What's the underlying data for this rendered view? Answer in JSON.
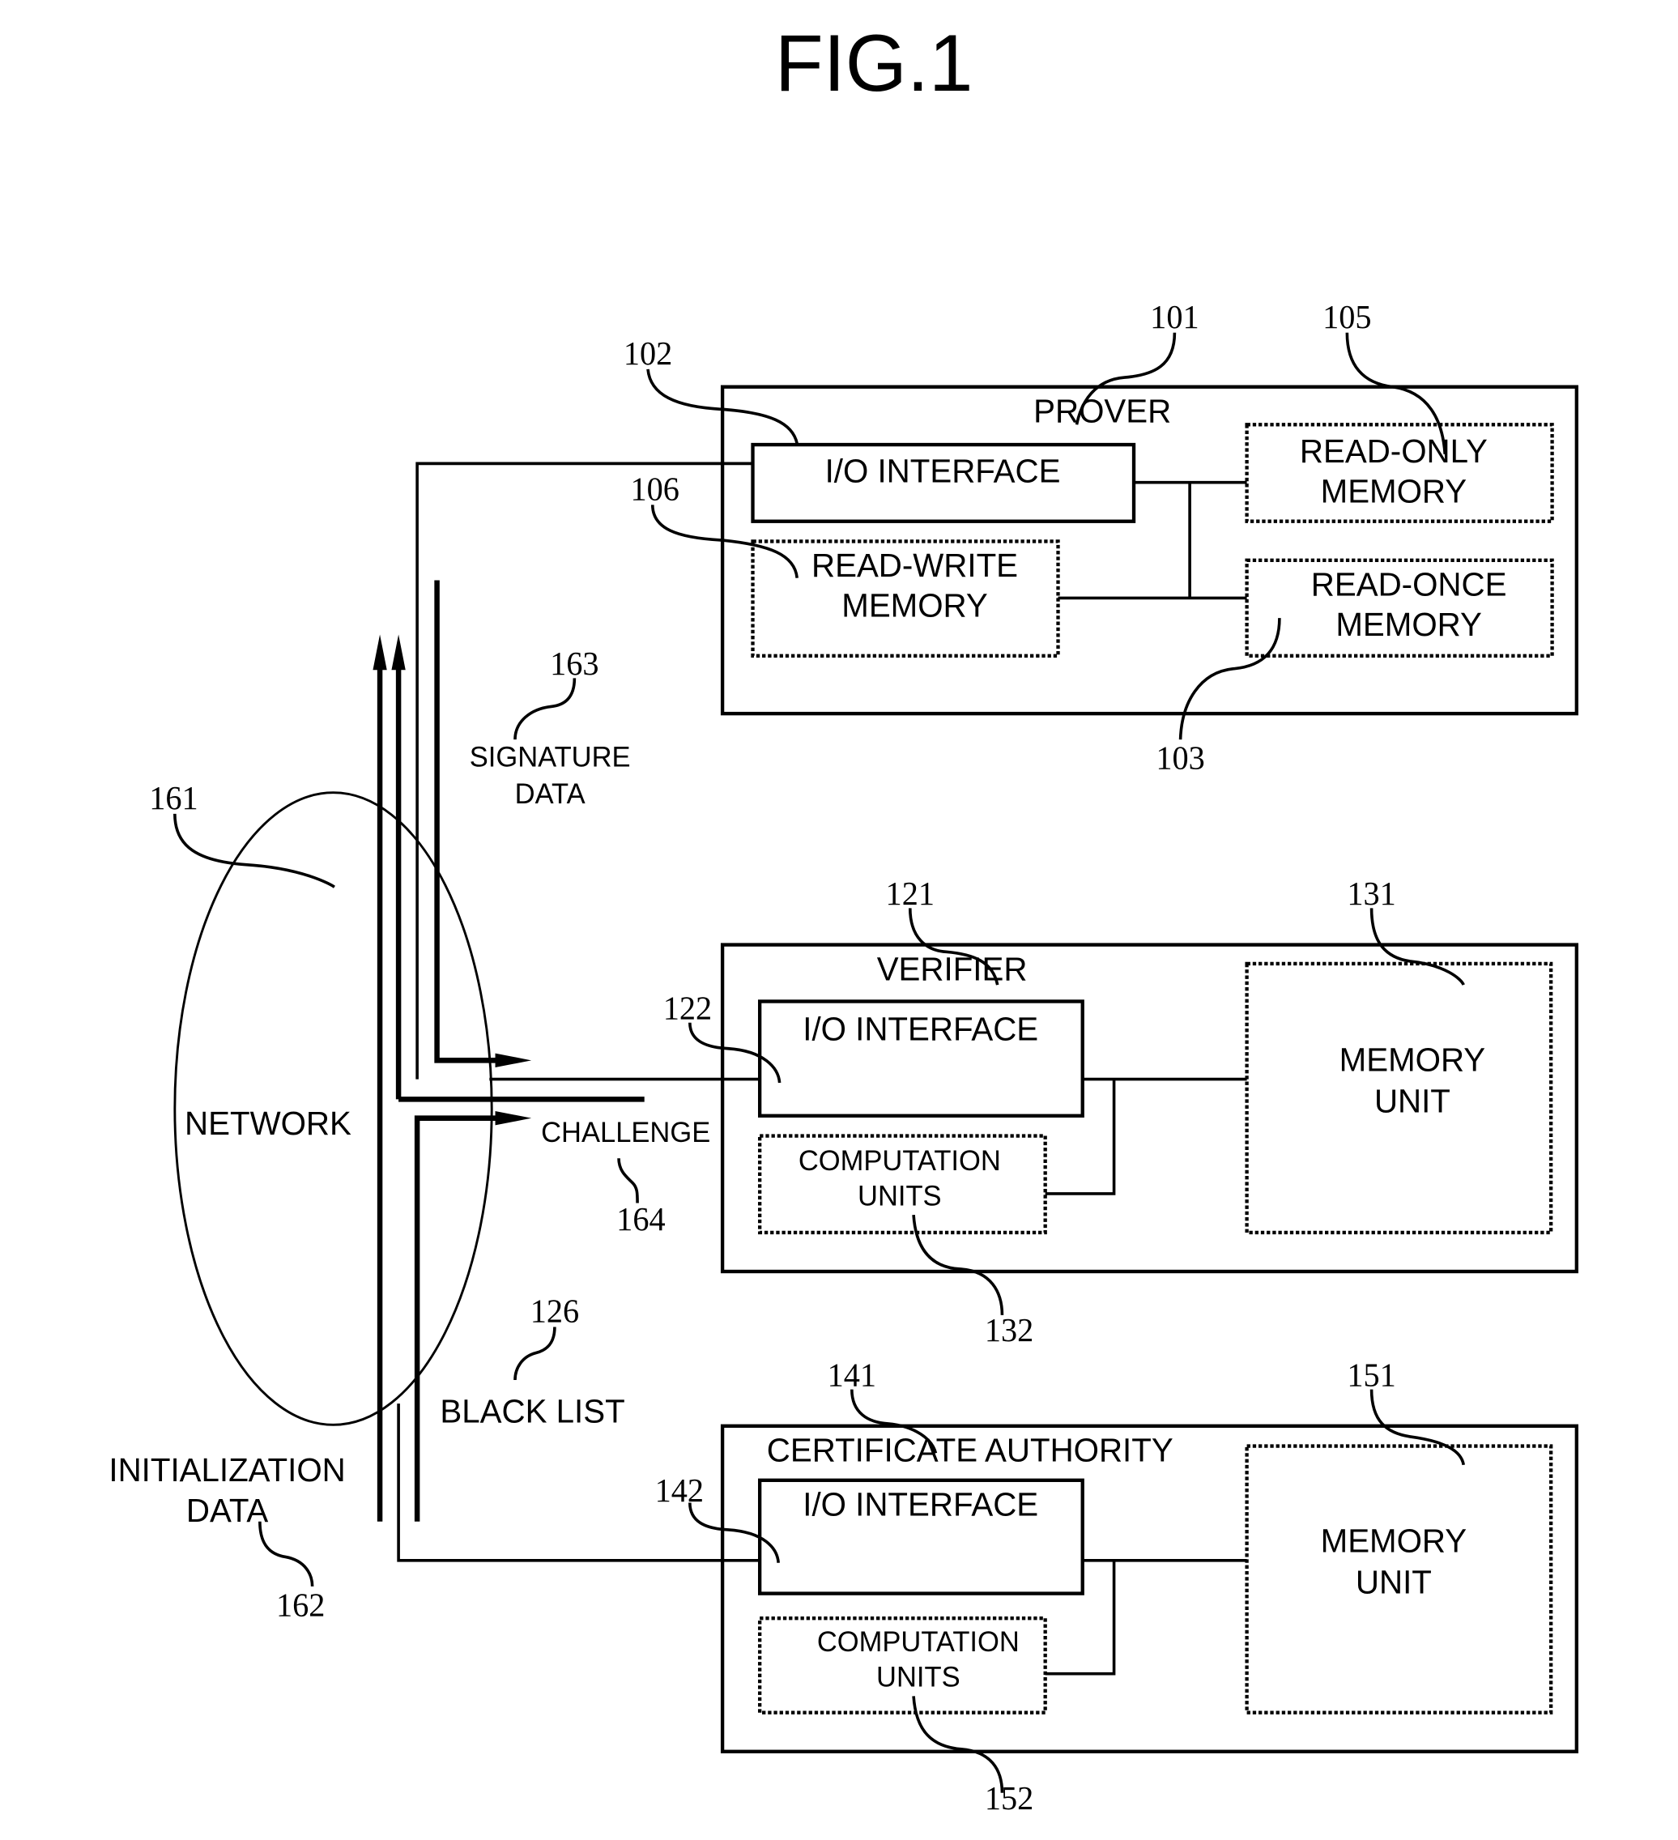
{
  "figure": {
    "title": "FIG.1"
  },
  "prover": {
    "title": "PROVER",
    "ref": "101",
    "io_interface": {
      "label": "I/O INTERFACE",
      "ref": "102"
    },
    "read_only_memory": {
      "line1": "READ-ONLY",
      "line2": "MEMORY",
      "ref": "105"
    },
    "read_write_memory": {
      "line1": "READ-WRITE",
      "line2": "MEMORY",
      "ref": "106"
    },
    "read_once_memory": {
      "line1": "READ-ONCE",
      "line2": "MEMORY",
      "ref": "103"
    }
  },
  "verifier": {
    "title": "VERIFIER",
    "ref": "121",
    "io_interface": {
      "label": "I/O INTERFACE",
      "ref": "122"
    },
    "computation_units": {
      "line1": "COMPUTATION",
      "line2": "UNITS",
      "ref": "132"
    },
    "memory_unit": {
      "line1": "MEMORY",
      "line2": "UNIT",
      "ref": "131"
    }
  },
  "certificate_authority": {
    "title": "CERTIFICATE AUTHORITY",
    "ref": "141",
    "io_interface": {
      "label": "I/O INTERFACE",
      "ref": "142"
    },
    "computation_units": {
      "line1": "COMPUTATION",
      "line2": "UNITS",
      "ref": "152"
    },
    "memory_unit": {
      "line1": "MEMORY",
      "line2": "UNIT",
      "ref": "151"
    }
  },
  "network": {
    "label": "NETWORK",
    "ref": "161"
  },
  "flows": {
    "signature_data": {
      "line1": "SIGNATURE",
      "line2": "DATA",
      "ref": "163"
    },
    "challenge": {
      "label": "CHALLENGE",
      "ref": "164"
    },
    "black_list": {
      "label": "BLACK LIST",
      "ref": "126"
    },
    "initialization_data": {
      "line1": "INITIALIZATION",
      "line2": "DATA",
      "ref": "162"
    }
  }
}
